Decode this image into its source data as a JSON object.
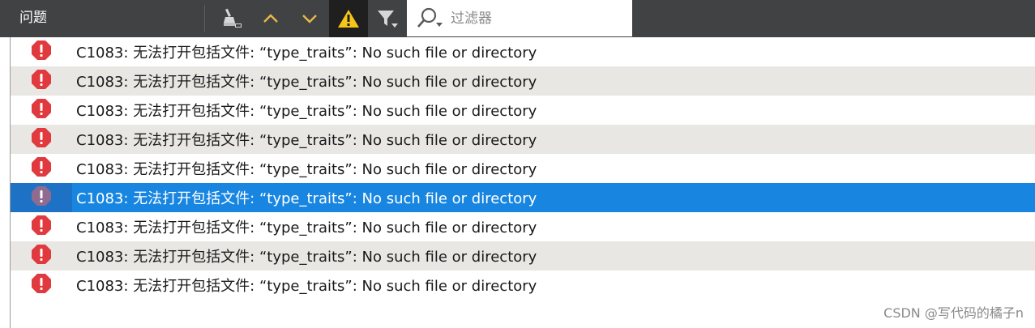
{
  "panel": {
    "title": "问题"
  },
  "toolbar": {
    "buttons": [
      {
        "name": "clear-icon"
      },
      {
        "name": "chevron-up-icon"
      },
      {
        "name": "chevron-down-icon"
      },
      {
        "name": "warning-icon",
        "active": true
      },
      {
        "name": "filter-icon"
      }
    ]
  },
  "filter": {
    "placeholder": "过滤器",
    "value": ""
  },
  "issues": [
    {
      "severity": "error",
      "message": "C1083: 无法打开包括文件: “type_traits”: No such file or directory"
    },
    {
      "severity": "error",
      "message": "C1083: 无法打开包括文件: “type_traits”: No such file or directory"
    },
    {
      "severity": "error",
      "message": "C1083: 无法打开包括文件: “type_traits”: No such file or directory"
    },
    {
      "severity": "error",
      "message": "C1083: 无法打开包括文件: “type_traits”: No such file or directory"
    },
    {
      "severity": "error",
      "message": "C1083: 无法打开包括文件: “type_traits”: No such file or directory"
    },
    {
      "severity": "error",
      "message": "C1083: 无法打开包括文件: “type_traits”: No such file or directory",
      "selected": true
    },
    {
      "severity": "error",
      "message": "C1083: 无法打开包括文件: “type_traits”: No such file or directory"
    },
    {
      "severity": "error",
      "message": "C1083: 无法打开包括文件: “type_traits”: No such file or directory"
    },
    {
      "severity": "error",
      "message": "C1083: 无法打开包括文件: “type_traits”: No such file or directory"
    }
  ],
  "watermark": "CSDN @写代码的橘子n",
  "colors": {
    "toolbar_bg": "#404244",
    "row_alt": "#e8e7e4",
    "selected": "#1886e0",
    "error": "#e0393e",
    "warning": "#f5c518",
    "chevron": "#e8b84a"
  }
}
